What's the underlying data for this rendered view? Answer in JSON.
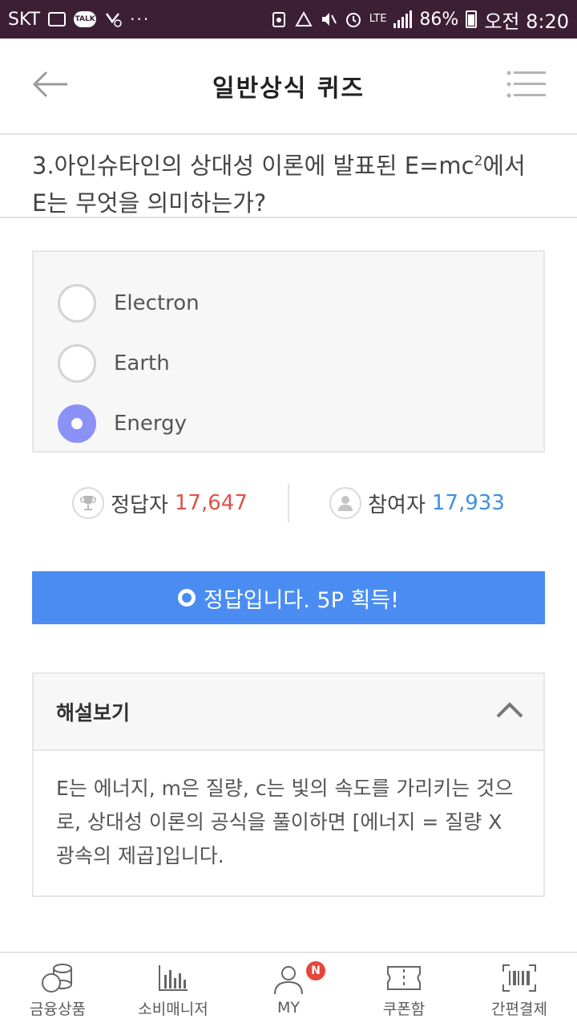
{
  "status_bar": {
    "carrier": "SKT",
    "network": "LTE",
    "battery": "86%",
    "time": "오전 8:20",
    "talk_label": "TALK",
    "more": "···"
  },
  "header": {
    "title": "일반상식 퀴즈",
    "back_icon": "arrow-left-icon",
    "menu_icon": "hamburger-menu-icon"
  },
  "question": {
    "text_before": "3.아인슈타인의 상대성 이론에 발표된 E=mc",
    "superscript": "2",
    "text_after": "에서 E는 무엇을 의미하는가?"
  },
  "options": [
    {
      "label": "Electron",
      "selected": false
    },
    {
      "label": "Earth",
      "selected": false
    },
    {
      "label": "Energy",
      "selected": true
    }
  ],
  "stats": {
    "correct_label": "정답자",
    "correct_value": "17,647",
    "participants_label": "참여자",
    "participants_value": "17,933"
  },
  "result": {
    "text": "정답입니다. 5P 획득!"
  },
  "explanation": {
    "title": "해설보기",
    "body": "E는 에너지, m은 질량, c는 빛의 속도를 가리키는 것으로, 상대성 이론의 공식을 풀이하면 [에너지 = 질량 X 광속의 제곱]입니다."
  },
  "bottom_nav": [
    {
      "label": "금융상품",
      "icon": "coins-icon"
    },
    {
      "label": "소비매니저",
      "icon": "bar-chart-icon"
    },
    {
      "label": "MY",
      "icon": "user-icon",
      "badge": "N"
    },
    {
      "label": "쿠폰함",
      "icon": "ticket-icon"
    },
    {
      "label": "간편결제",
      "icon": "barcode-icon"
    }
  ],
  "colors": {
    "status_bar_bg": "#3d1f35",
    "accent_blue": "#4a8cf2",
    "radio_selected": "#8c91f5",
    "correct_red": "#e0514b",
    "participants_blue": "#3f8fe4",
    "badge_red": "#e5453c"
  }
}
